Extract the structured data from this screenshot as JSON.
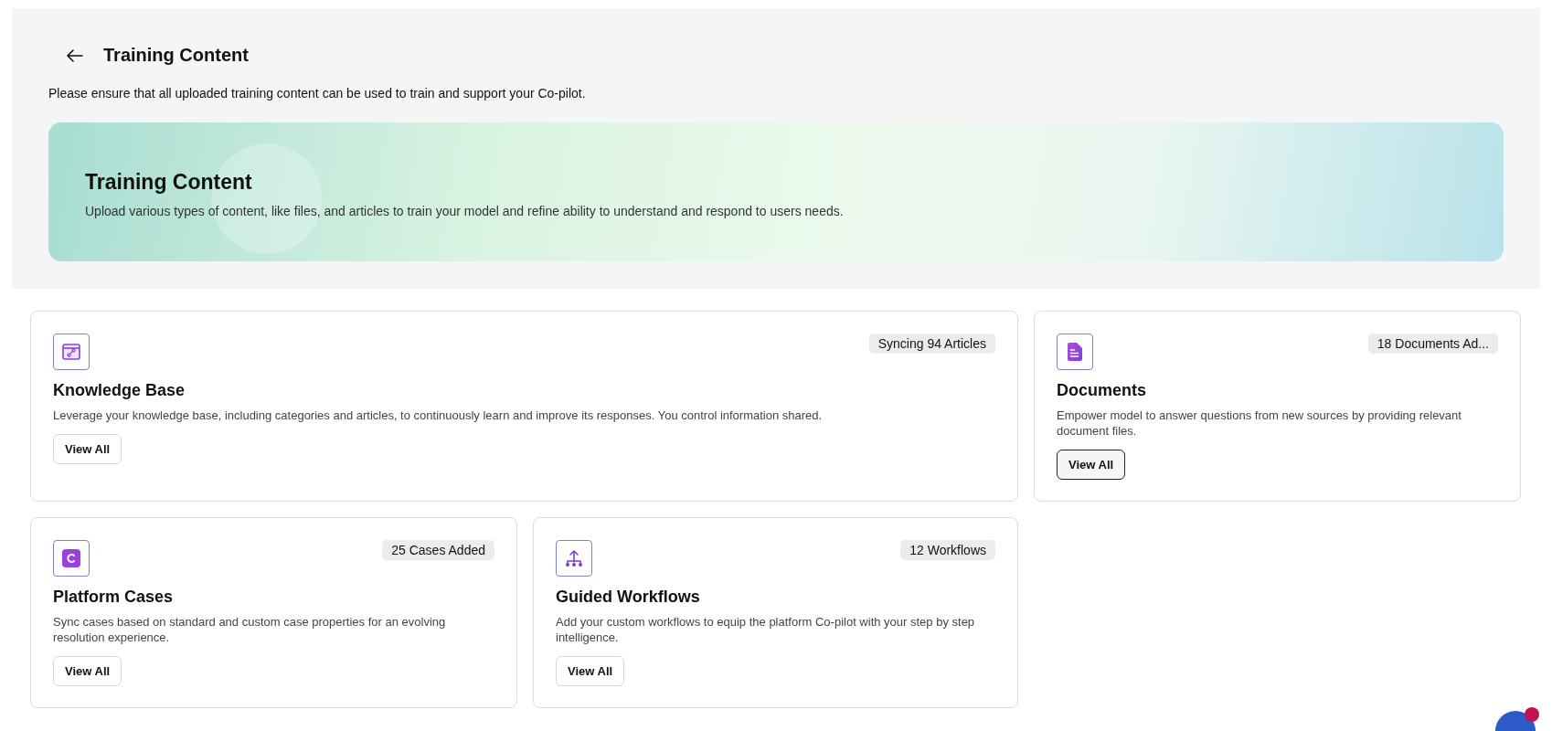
{
  "header": {
    "title": "Training Content",
    "subtitle": "Please ensure that all uploaded training content can be used to train and support your Co-pilot."
  },
  "banner": {
    "title": "Training Content",
    "description": "Upload various types of content, like files, and articles to train your model and refine ability to understand and respond to users needs."
  },
  "cards": [
    {
      "kind": "knowledge",
      "wide": true,
      "title": "Knowledge Base",
      "badge": "Syncing 94 Articles",
      "description": "Leverage your knowledge base, including categories and articles, to continuously learn and improve its responses. You control information shared.",
      "button": "View All",
      "hovered": false
    },
    {
      "kind": "documents",
      "wide": false,
      "title": "Documents",
      "badge": "18 Documents Ad...",
      "description": "Empower model to answer questions from new sources by providing relevant document files.",
      "button": "View All",
      "hovered": true
    },
    {
      "kind": "cases",
      "wide": false,
      "title": "Platform Cases",
      "badge": "25 Cases Added",
      "description": "Sync cases based on standard and custom case properties for an evolving resolution experience.",
      "button": "View All",
      "hovered": false
    },
    {
      "kind": "workflows",
      "wide": false,
      "title": "Guided Workflows",
      "badge": "12 Workflows",
      "description": "Add your custom workflows to equip the platform Co-pilot with your step by step intelligence.",
      "button": "View All",
      "hovered": false
    }
  ]
}
